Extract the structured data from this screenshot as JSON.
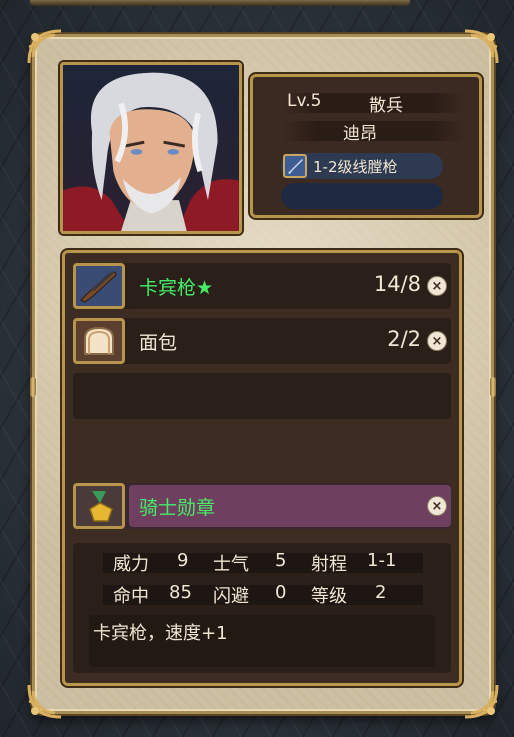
{
  "unit": {
    "level": "Lv.5",
    "class": "散兵",
    "name": "迪昂",
    "weapon": "1-2级线膛枪"
  },
  "inventory": [
    {
      "name": "卡宾枪★",
      "count": "14/8",
      "icon": "rifle-icon",
      "highlight": "green"
    },
    {
      "name": "面包",
      "count": "2/2",
      "icon": "bread-icon",
      "highlight": "none"
    }
  ],
  "accessory": {
    "name": "骑士勋章",
    "icon": "medal-icon"
  },
  "stats": {
    "power_label": "威力",
    "power": "9",
    "morale_label": "士气",
    "morale": "5",
    "range_label": "射程",
    "range": "1-1",
    "hit_label": "命中",
    "hit": "85",
    "evade_label": "闪避",
    "evade": "0",
    "grade_label": "等级",
    "grade": "2"
  },
  "description": "卡宾枪，速度+1",
  "colors": {
    "panel": "#cdbfa1",
    "frame_gold": "#b8954d",
    "dark_slot": "#2b1f19",
    "accent_green": "#44ee66",
    "accessory_bar": "#6e3f5e"
  }
}
